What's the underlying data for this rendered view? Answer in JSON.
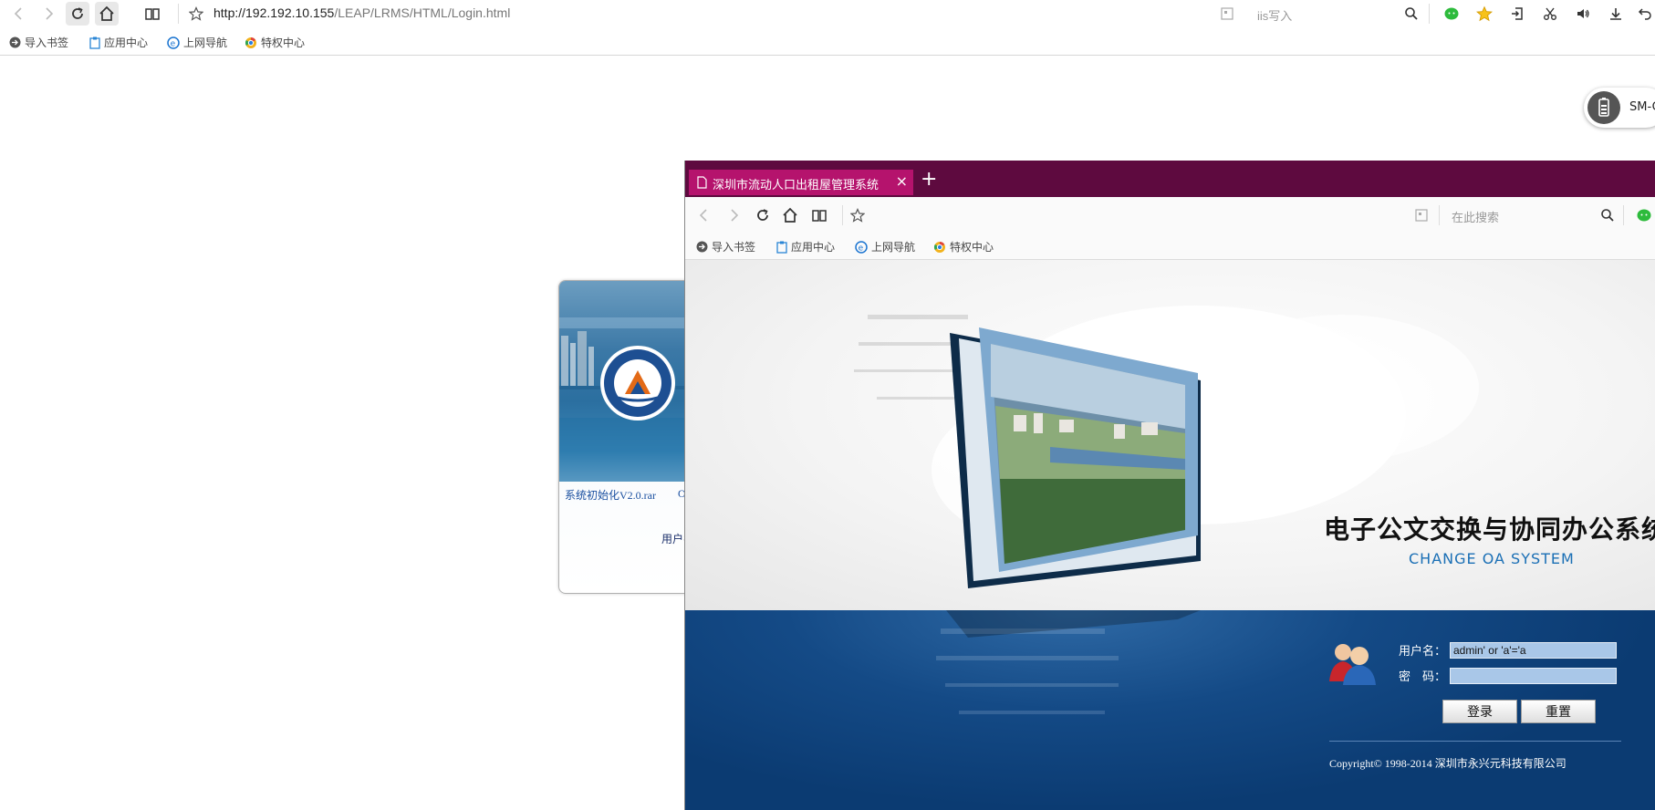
{
  "outer_browser": {
    "url_host": "http://192.192.10.155",
    "url_path": "/LEAP/LRMS/HTML/Login.html",
    "search_text": "iis写入",
    "bookmarks": [
      "导入书签",
      "应用中心",
      "上网导航",
      "特权中心"
    ]
  },
  "device_pill": {
    "label": "SM-G"
  },
  "old_login": {
    "link1": "系统初始化V2.0.rar",
    "link2": "O",
    "user_label": "用户名"
  },
  "inner_browser": {
    "tab_title": "深圳市流动人口出租屋管理系统",
    "tab_close": "×",
    "new_tab": "+",
    "search_placeholder": "在此搜索",
    "bookmarks": [
      "导入书签",
      "应用中心",
      "上网导航",
      "特权中心"
    ]
  },
  "login_page": {
    "title": "电子公文交换与协同办公系统",
    "subtitle": "CHANGE OA SYSTEM",
    "username_label": "用户名：",
    "password_label": "密　码：",
    "username_value": "admin' or 'a'='a",
    "password_value": "",
    "login_button": "登录",
    "reset_button": "重置",
    "copyright": "Copyright© 1998-2014 深圳市永兴元科技有限公司"
  },
  "colors": {
    "inner_tabbar": "#5e0a3f",
    "inner_tab_active": "#b5136d",
    "login_panel": "#0b3b72",
    "subtitle": "#1a6fb5"
  }
}
